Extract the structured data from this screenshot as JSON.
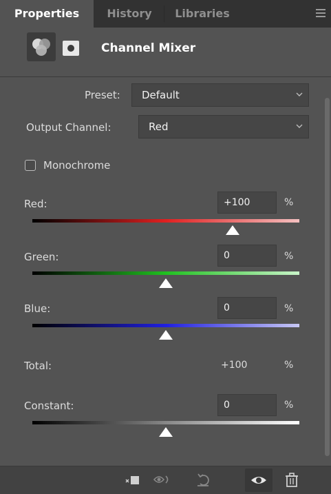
{
  "tabs": [
    {
      "label": "Properties",
      "active": true
    },
    {
      "label": "History",
      "active": false
    },
    {
      "label": "Libraries",
      "active": false
    }
  ],
  "header": {
    "title": "Channel Mixer",
    "adjustment_icon": "channel-mixer-icon",
    "mask_icon": "layer-mask-icon"
  },
  "preset": {
    "label": "Preset:",
    "value": "Default"
  },
  "output_channel": {
    "label": "Output Channel:",
    "value": "Red"
  },
  "monochrome": {
    "label": "Monochrome",
    "checked": false
  },
  "channels": [
    {
      "label": "Red:",
      "value": "+100",
      "unit": "%",
      "percent": 100,
      "colors": [
        "#000000",
        "#e02020",
        "#f4c0c0"
      ]
    },
    {
      "label": "Green:",
      "value": "0",
      "unit": "%",
      "percent": 0,
      "colors": [
        "#000000",
        "#20c020",
        "#c8f4c8"
      ]
    },
    {
      "label": "Blue:",
      "value": "0",
      "unit": "%",
      "percent": 0,
      "colors": [
        "#000000",
        "#2020e0",
        "#c8c8f4"
      ]
    }
  ],
  "total": {
    "label": "Total:",
    "value": "+100",
    "unit": "%"
  },
  "constant": {
    "label": "Constant:",
    "value": "0",
    "unit": "%",
    "percent": 0,
    "colors": [
      "#000000",
      "#888888",
      "#ffffff"
    ]
  },
  "footer_icons": [
    "clip-to-layer-icon",
    "view-previous-state-icon",
    "reset-icon",
    "visibility-eye-icon",
    "trash-icon"
  ],
  "colors": {
    "panel": "#535353",
    "tabbar": "#323232",
    "field": "#464646"
  }
}
